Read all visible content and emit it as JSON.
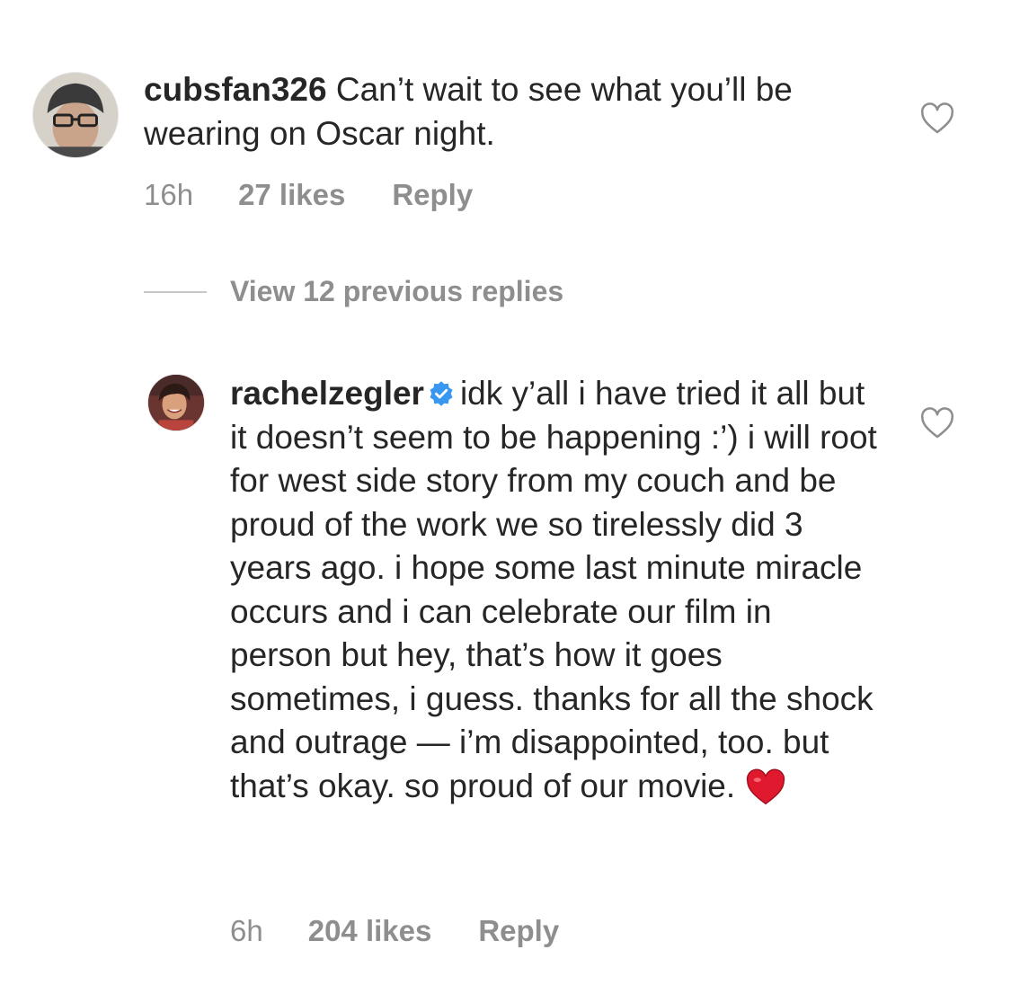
{
  "comments": [
    {
      "username": "cubsfan326",
      "text": "Can’t wait to see what you’ll be wearing on Oscar night.",
      "time": "16h",
      "likes": "27 likes",
      "reply_label": "Reply"
    },
    {
      "username": "rachelzegler",
      "verified": true,
      "text": "idk y’all i have tried it all but it doesn’t seem to be happening :’) i will root for west side story from my couch and be proud of the work we so tirelessly did 3 years ago. i hope some last minute miracle occurs and i can celebrate our film in person but hey, that’s how it goes sometimes, i guess. thanks for all the shock and outrage — i’m disappointed, too. but that’s okay. so proud of our movie.",
      "time": "6h",
      "likes": "204 likes",
      "reply_label": "Reply"
    }
  ],
  "view_replies_label": "View 12 previous replies",
  "icons": {
    "like": "heart-outline-icon",
    "verified": "verified-badge-icon",
    "emoji": "red-heart-emoji"
  },
  "colors": {
    "text": "#262626",
    "meta": "#8e8e8e",
    "verified": "#3897f0",
    "heart_emoji": "#e0192e"
  }
}
